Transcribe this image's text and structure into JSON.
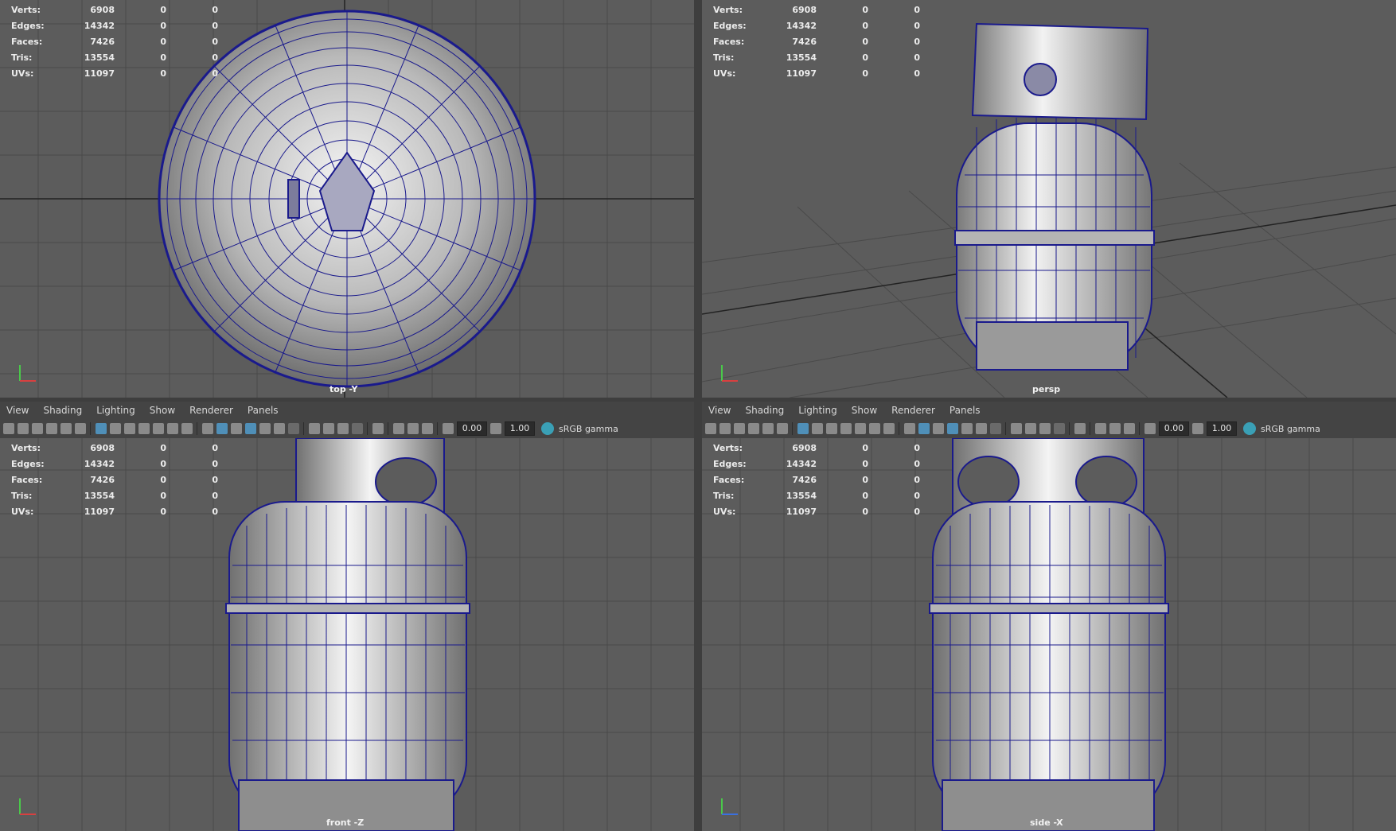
{
  "hud_labels": {
    "verts": "Verts:",
    "edges": "Edges:",
    "faces": "Faces:",
    "tris": "Tris:",
    "uvs": "UVs:"
  },
  "hud_values": {
    "verts": "6908",
    "edges": "14342",
    "faces": "7426",
    "tris": "13554",
    "uvs": "11097",
    "zero": "0"
  },
  "cameras": {
    "top": "top -Y",
    "persp": "persp",
    "front": "front -Z",
    "side": "side -X"
  },
  "panel_menu": {
    "view": "View",
    "shading": "Shading",
    "lighting": "Lighting",
    "show": "Show",
    "renderer": "Renderer",
    "panels": "Panels"
  },
  "toolbar": {
    "exposure": "0.00",
    "gamma": "1.00",
    "color_space": "sRGB gamma"
  },
  "icons": [
    "camera-icon",
    "grid-icon",
    "wireframe-icon",
    "smooth-shade-icon",
    "textured-icon",
    "lighting-icon",
    "isolate-icon",
    "xray-icon",
    "exposure-icon",
    "gamma-icon",
    "color-management-icon"
  ],
  "colors": {
    "viewport_bg": "#5c5c5c",
    "wire": "#1a1a8c",
    "selection": "#4f8fb8"
  }
}
